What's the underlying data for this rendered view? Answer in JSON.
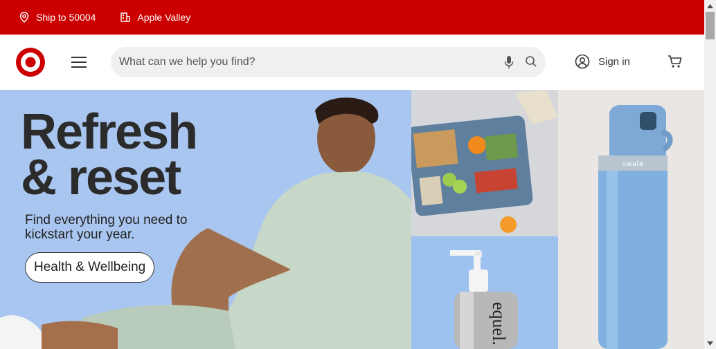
{
  "utility_bar": {
    "ship_to_label": "Ship to 50004",
    "store_label": "Apple Valley"
  },
  "header": {
    "search_placeholder": "What can we help you find?",
    "sign_in_label": "Sign in"
  },
  "hero": {
    "title_line1": "Refresh",
    "title_line2": "& reset",
    "subtitle": "Find everything you need to kickstart your year.",
    "button_label": "Health & Wellbeing"
  },
  "tiles": {
    "bottle_brand": "owala",
    "soap_brand": "equel."
  },
  "colors": {
    "brand_red": "#cc0000",
    "hero_blue": "#a8c6ef",
    "header_bg": "#ffffff"
  },
  "icons": {
    "location": "location-pin-icon",
    "store": "store-icon",
    "menu": "hamburger-menu-icon",
    "mic": "microphone-icon",
    "search": "search-icon",
    "account": "account-icon",
    "cart": "cart-icon"
  }
}
